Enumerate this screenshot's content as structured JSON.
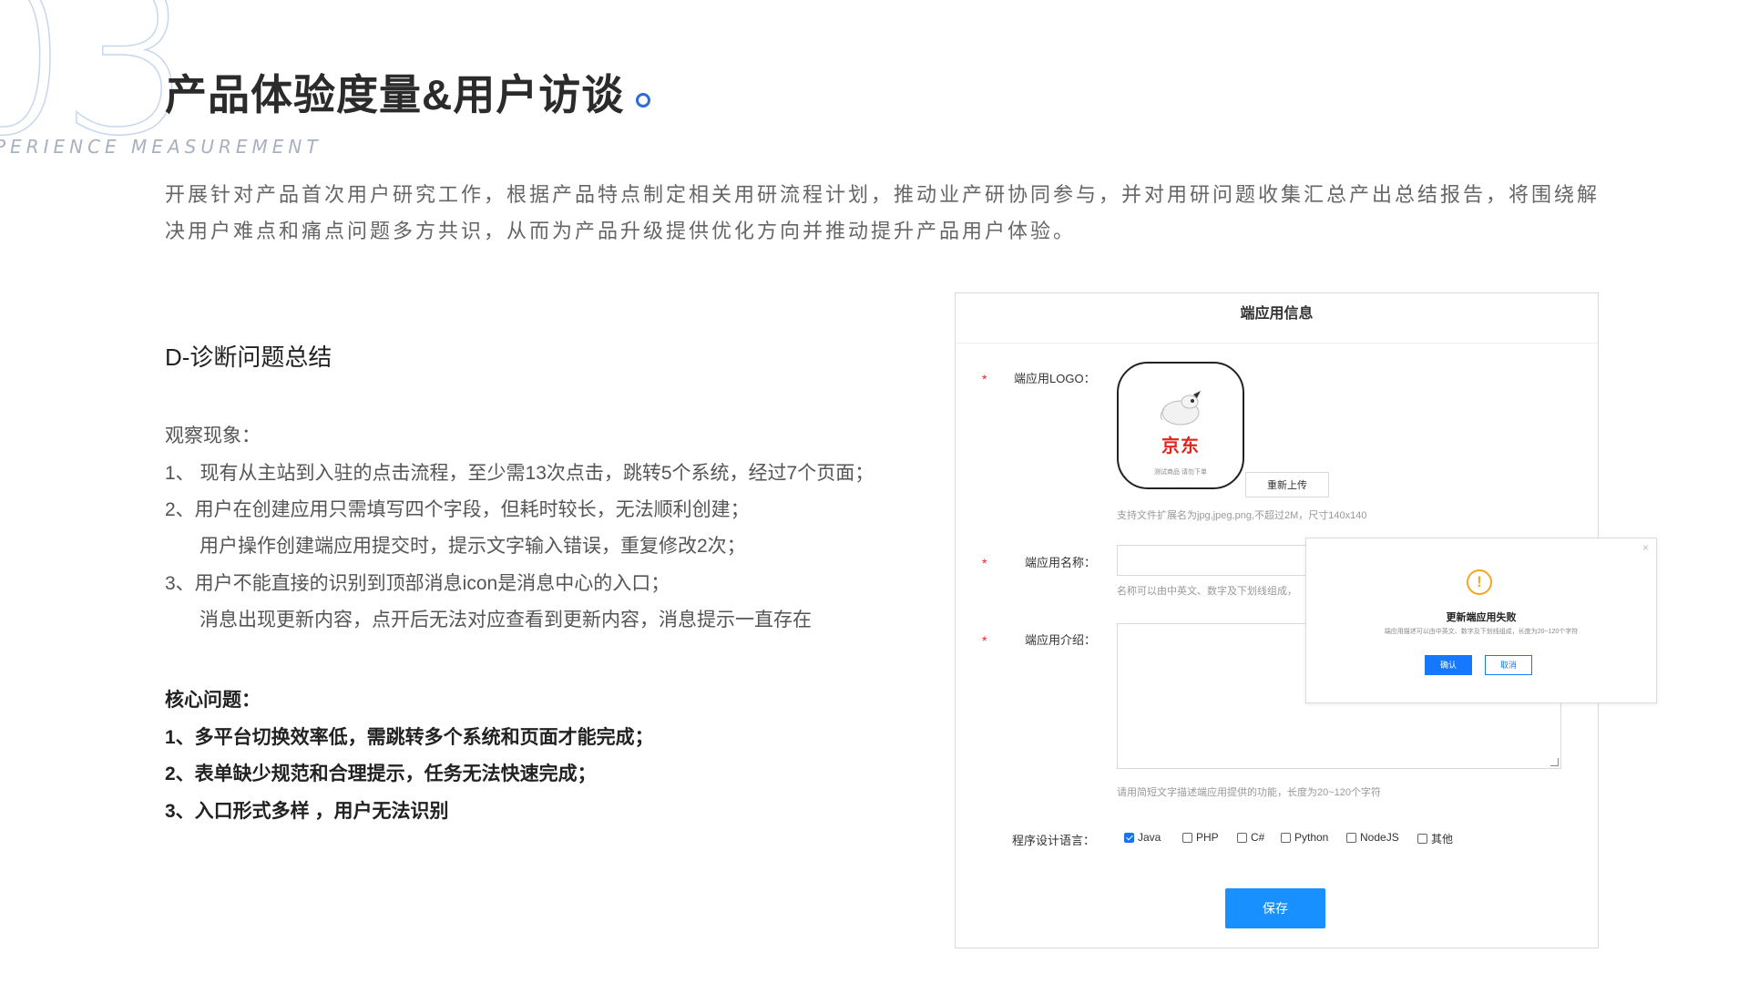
{
  "header": {
    "section_number": "03",
    "title": "产品体验度量&用户访谈",
    "subtitle_en": "PERIENCE MEASUREMENT",
    "intro": "开展针对产品首次用户研究工作，根据产品特点制定相关用研流程计划，推动业产研协同参与，并对用研问题收集汇总产出总结报告，将围绕解决用户难点和痛点问题多方共识，从而为产品升级提供优化方向并推动提升产品用户体验。",
    "accent_color": "#2f6bdc"
  },
  "summary": {
    "heading": "D-诊断问题总结",
    "observation_label": "观察现象：",
    "observations": [
      "1、 现有从主站到入驻的点击流程，至少需13次点击，跳转5个系统，经过7个页面；",
      "2、用户在创建应用只需填写四个字段，但耗时较长，无法顺利创建；",
      "用户操作创建端应用提交时，提示文字输入错误，重复修改2次；",
      "3、用户不能直接的识别到顶部消息icon是消息中心的入口；",
      "消息出现更新内容，点开后无法对应查看到更新内容，消息提示一直存在"
    ],
    "core_label": "核心问题：",
    "core_issues": [
      "1、多平台切换效率低，需跳转多个系统和页面才能完成；",
      "2、表单缺少规范和合理提示，任务无法快速完成；",
      "3、入口形式多样 ，用户无法识别"
    ]
  },
  "form": {
    "title": "端应用信息",
    "required_mark": "*",
    "logo_label": "端应用LOGO：",
    "logo_text": "京东",
    "logo_caption": "测试商品  请勿下单",
    "reupload_button": "重新上传",
    "logo_hint": "支持文件扩展名为jpg,jpeg,png,不超过2M，尺寸140x140",
    "name_label": "端应用名称：",
    "name_value": "",
    "name_hint": "名称可以由中英文、数字及下划线组成，",
    "intro_label": "端应用介绍：",
    "intro_value": "",
    "intro_hint": "请用简短文字描述端应用提供的功能，长度为20~120个字符",
    "lang_label": "程序设计语言：",
    "languages": [
      {
        "label": "Java",
        "checked": true
      },
      {
        "label": "PHP",
        "checked": false
      },
      {
        "label": "C#",
        "checked": false
      },
      {
        "label": "Python",
        "checked": false
      },
      {
        "label": "NodeJS",
        "checked": false
      },
      {
        "label": "其他",
        "checked": false
      }
    ],
    "save_button": "保存",
    "primary_color": "#1890ff"
  },
  "modal": {
    "close_symbol": "×",
    "icon": "warning-icon",
    "icon_glyph": "!",
    "title": "更新端应用失败",
    "description": "端应用描述可以由中英文、数字及下划线组成，长度为20~120个字符",
    "ok_button": "确认",
    "cancel_button": "取消"
  }
}
